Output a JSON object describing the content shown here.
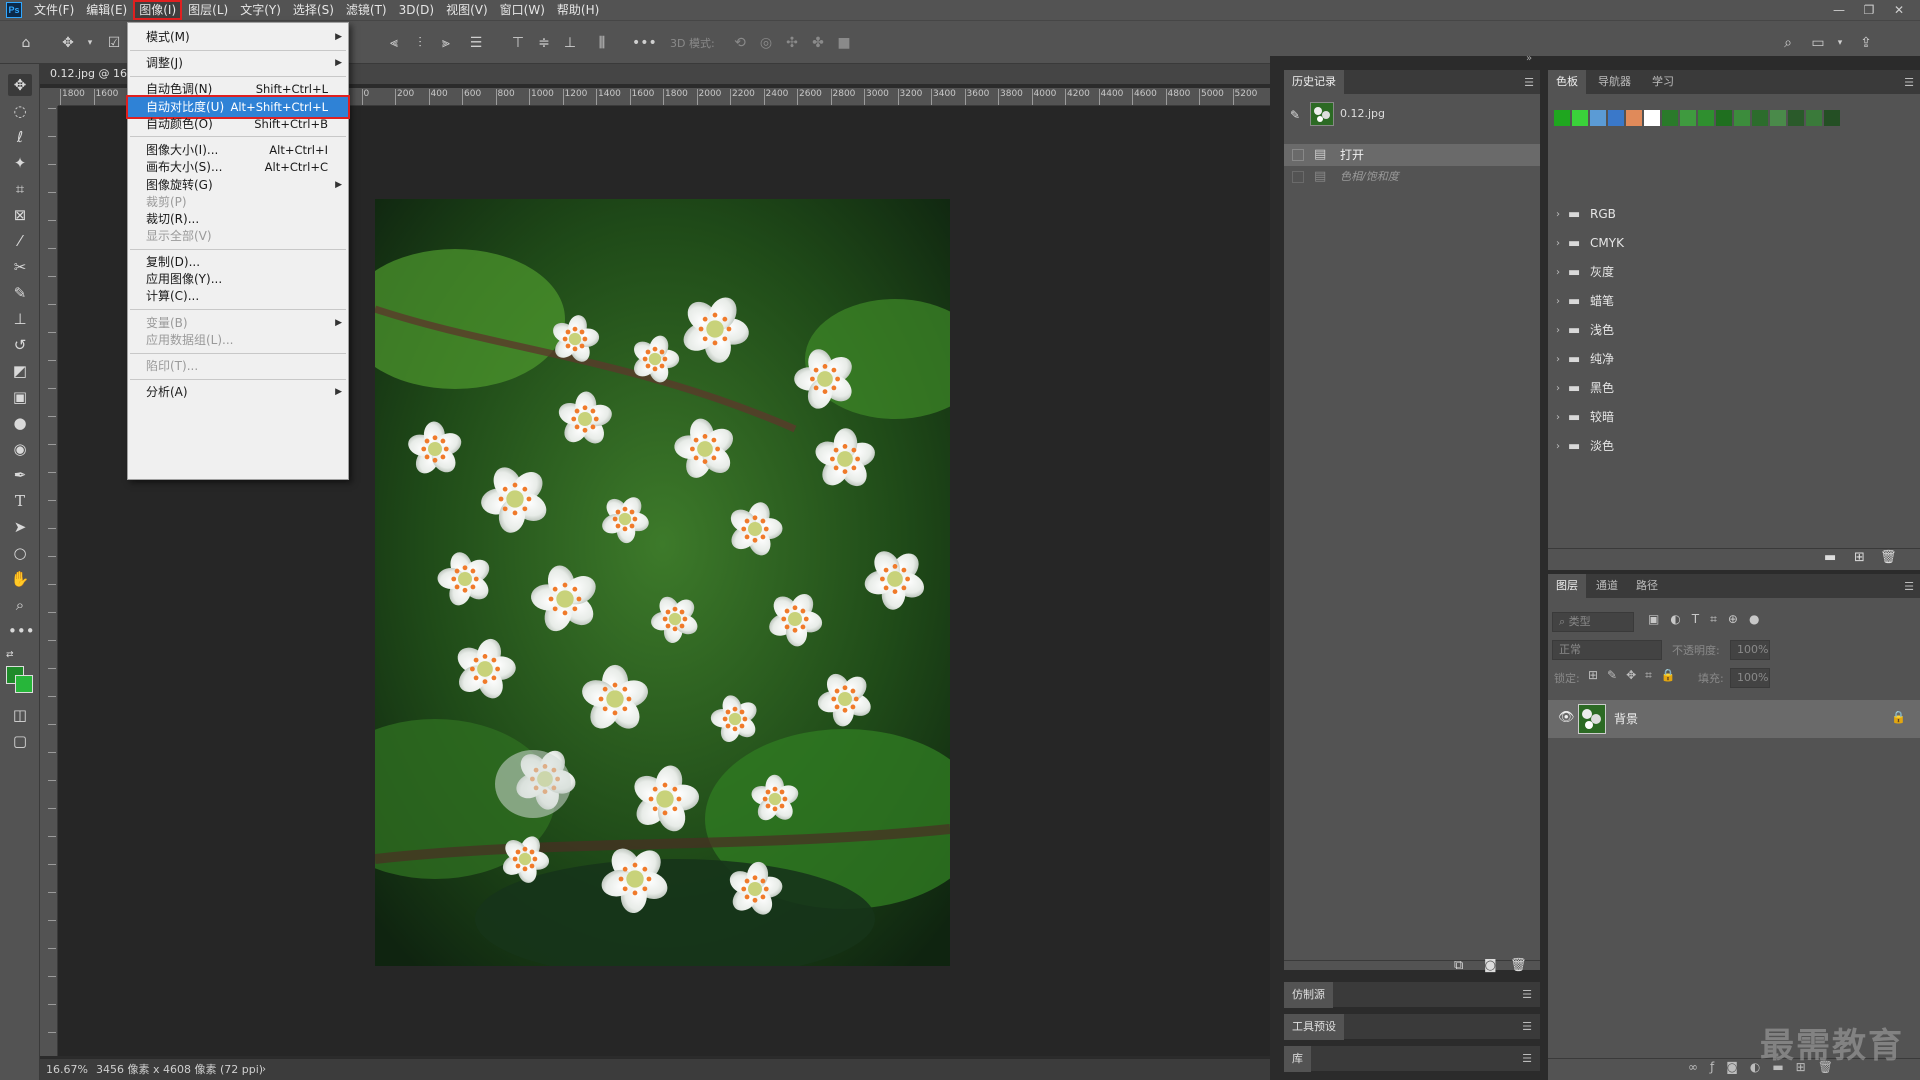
{
  "app": {
    "logo": "Ps"
  },
  "menubar": {
    "items": [
      "文件(F)",
      "编辑(E)",
      "图像(I)",
      "图层(L)",
      "文字(Y)",
      "选择(S)",
      "滤镜(T)",
      "3D(D)",
      "视图(V)",
      "窗口(W)",
      "帮助(H)"
    ],
    "active_index": 2
  },
  "window_controls": {
    "minimize": "—",
    "restore": "❐",
    "close": "✕"
  },
  "options_bar": {
    "mode3d_label": "3D 模式:"
  },
  "document": {
    "tab_title": "0.12.jpg @ 16.",
    "status_zoom": "16.67%",
    "status_info": "3456 像素 x 4608 像素 (72 ppi)"
  },
  "ruler": {
    "top": [
      "1800",
      "1600",
      "1400",
      "1200",
      "1000",
      "800",
      "600",
      "400",
      "200",
      "0",
      "200",
      "400",
      "600",
      "800",
      "1000",
      "1200",
      "1400",
      "1600",
      "1800",
      "2000",
      "2200",
      "2400",
      "2600",
      "2800",
      "3000",
      "3200",
      "3400",
      "3600",
      "3800",
      "4000",
      "4200",
      "4400",
      "4600",
      "4800",
      "5000",
      "5200"
    ]
  },
  "image_menu": {
    "items": [
      {
        "label": "模式(M)",
        "shortcut": "",
        "submenu": true,
        "disabled": false
      },
      {
        "label": "调整(J)",
        "shortcut": "",
        "submenu": true,
        "disabled": false
      },
      {
        "label": "自动色调(N)",
        "shortcut": "Shift+Ctrl+L",
        "submenu": false,
        "disabled": false
      },
      {
        "label": "自动对比度(U)",
        "shortcut": "Alt+Shift+Ctrl+L",
        "submenu": false,
        "disabled": false,
        "highlighted": true
      },
      {
        "label": "自动颜色(O)",
        "shortcut": "Shift+Ctrl+B",
        "submenu": false,
        "disabled": false
      },
      {
        "label": "图像大小(I)...",
        "shortcut": "Alt+Ctrl+I",
        "submenu": false,
        "disabled": false
      },
      {
        "label": "画布大小(S)...",
        "shortcut": "Alt+Ctrl+C",
        "submenu": false,
        "disabled": false
      },
      {
        "label": "图像旋转(G)",
        "shortcut": "",
        "submenu": true,
        "disabled": false
      },
      {
        "label": "裁剪(P)",
        "shortcut": "",
        "submenu": false,
        "disabled": true
      },
      {
        "label": "裁切(R)...",
        "shortcut": "",
        "submenu": false,
        "disabled": false
      },
      {
        "label": "显示全部(V)",
        "shortcut": "",
        "submenu": false,
        "disabled": true
      },
      {
        "label": "复制(D)...",
        "shortcut": "",
        "submenu": false,
        "disabled": false
      },
      {
        "label": "应用图像(Y)...",
        "shortcut": "",
        "submenu": false,
        "disabled": false
      },
      {
        "label": "计算(C)...",
        "shortcut": "",
        "submenu": false,
        "disabled": false
      },
      {
        "label": "变量(B)",
        "shortcut": "",
        "submenu": true,
        "disabled": true
      },
      {
        "label": "应用数据组(L)...",
        "shortcut": "",
        "submenu": false,
        "disabled": true
      },
      {
        "label": "陷印(T)...",
        "shortcut": "",
        "submenu": false,
        "disabled": true
      },
      {
        "label": "分析(A)",
        "shortcut": "",
        "submenu": true,
        "disabled": false
      }
    ]
  },
  "history_panel": {
    "tab": "历史记录",
    "snapshot": "0.12.jpg",
    "entries": [
      {
        "label": "打开",
        "selected": true
      },
      {
        "label": "色相/饱和度",
        "selected": false
      }
    ]
  },
  "collapsed_panels": [
    "仿制源",
    "工具预设",
    "库"
  ],
  "swatches_panel": {
    "tabs": [
      "色板",
      "导航器",
      "学习"
    ],
    "colors": [
      "#1fa61f",
      "#3ad13a",
      "#5b9bd5",
      "#3a78c9",
      "#e08a5a",
      "#ffffff",
      "#2a7a2a",
      "#3f9a3f",
      "#2f8f2f",
      "#1f6f1f",
      "#3c8c3c",
      "#2c6c2c",
      "#4a8a4a",
      "#2a5a2a",
      "#3a7a3a",
      "#244f24"
    ],
    "groups": [
      "RGB",
      "CMYK",
      "灰度",
      "蜡笔",
      "浅色",
      "纯净",
      "黑色",
      "较暗",
      "淡色"
    ]
  },
  "layers_panel": {
    "tabs": [
      "图层",
      "通道",
      "路径"
    ],
    "filter_placeholder": "类型",
    "blend_mode": "正常",
    "opacity_label": "不透明度:",
    "opacity_value": "100%",
    "lock_label": "锁定:",
    "fill_label": "填充:",
    "fill_value": "100%",
    "layers": [
      {
        "name": "背景",
        "visible": true,
        "locked": true
      }
    ]
  },
  "watermark": "最需教育"
}
